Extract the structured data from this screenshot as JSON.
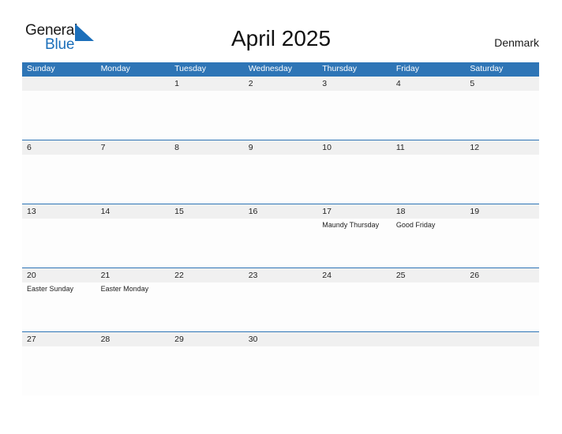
{
  "logo": {
    "word_one": "General",
    "word_two": "Blue",
    "triangle_icon": "triangle-icon",
    "blue_hex": "#1c6fba"
  },
  "header": {
    "title": "April 2025",
    "country": "Denmark"
  },
  "theme": {
    "header_blue": "#2e75b6",
    "band_gray": "#f0f0f0",
    "rule_blue": "#2e75b6",
    "text_dark": "#222222"
  },
  "calendar": {
    "month": "April",
    "year": "2025",
    "weekday_headers": [
      "Sunday",
      "Monday",
      "Tuesday",
      "Wednesday",
      "Thursday",
      "Friday",
      "Saturday"
    ],
    "weeks": [
      [
        {
          "day": "",
          "event": ""
        },
        {
          "day": "",
          "event": ""
        },
        {
          "day": "1",
          "event": ""
        },
        {
          "day": "2",
          "event": ""
        },
        {
          "day": "3",
          "event": ""
        },
        {
          "day": "4",
          "event": ""
        },
        {
          "day": "5",
          "event": ""
        }
      ],
      [
        {
          "day": "6",
          "event": ""
        },
        {
          "day": "7",
          "event": ""
        },
        {
          "day": "8",
          "event": ""
        },
        {
          "day": "9",
          "event": ""
        },
        {
          "day": "10",
          "event": ""
        },
        {
          "day": "11",
          "event": ""
        },
        {
          "day": "12",
          "event": ""
        }
      ],
      [
        {
          "day": "13",
          "event": ""
        },
        {
          "day": "14",
          "event": ""
        },
        {
          "day": "15",
          "event": ""
        },
        {
          "day": "16",
          "event": ""
        },
        {
          "day": "17",
          "event": "Maundy Thursday"
        },
        {
          "day": "18",
          "event": "Good Friday"
        },
        {
          "day": "19",
          "event": ""
        }
      ],
      [
        {
          "day": "20",
          "event": "Easter Sunday"
        },
        {
          "day": "21",
          "event": "Easter Monday"
        },
        {
          "day": "22",
          "event": ""
        },
        {
          "day": "23",
          "event": ""
        },
        {
          "day": "24",
          "event": ""
        },
        {
          "day": "25",
          "event": ""
        },
        {
          "day": "26",
          "event": ""
        }
      ],
      [
        {
          "day": "27",
          "event": ""
        },
        {
          "day": "28",
          "event": ""
        },
        {
          "day": "29",
          "event": ""
        },
        {
          "day": "30",
          "event": ""
        },
        {
          "day": "",
          "event": ""
        },
        {
          "day": "",
          "event": ""
        },
        {
          "day": "",
          "event": ""
        }
      ]
    ]
  }
}
